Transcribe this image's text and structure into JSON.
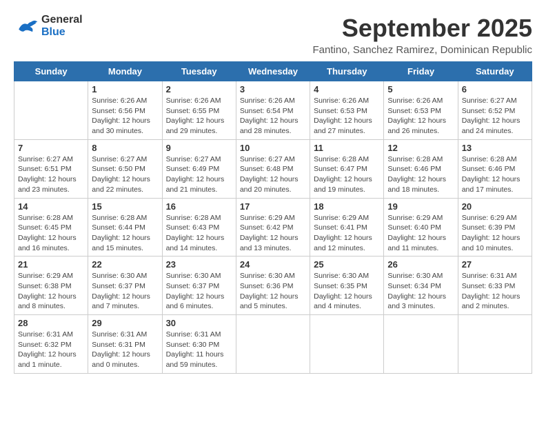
{
  "header": {
    "logo_general": "General",
    "logo_blue": "Blue",
    "month_title": "September 2025",
    "subtitle": "Fantino, Sanchez Ramirez, Dominican Republic"
  },
  "weekdays": [
    "Sunday",
    "Monday",
    "Tuesday",
    "Wednesday",
    "Thursday",
    "Friday",
    "Saturday"
  ],
  "weeks": [
    [
      {
        "day": "",
        "content": ""
      },
      {
        "day": "1",
        "content": "Sunrise: 6:26 AM\nSunset: 6:56 PM\nDaylight: 12 hours\nand 30 minutes."
      },
      {
        "day": "2",
        "content": "Sunrise: 6:26 AM\nSunset: 6:55 PM\nDaylight: 12 hours\nand 29 minutes."
      },
      {
        "day": "3",
        "content": "Sunrise: 6:26 AM\nSunset: 6:54 PM\nDaylight: 12 hours\nand 28 minutes."
      },
      {
        "day": "4",
        "content": "Sunrise: 6:26 AM\nSunset: 6:53 PM\nDaylight: 12 hours\nand 27 minutes."
      },
      {
        "day": "5",
        "content": "Sunrise: 6:26 AM\nSunset: 6:53 PM\nDaylight: 12 hours\nand 26 minutes."
      },
      {
        "day": "6",
        "content": "Sunrise: 6:27 AM\nSunset: 6:52 PM\nDaylight: 12 hours\nand 24 minutes."
      }
    ],
    [
      {
        "day": "7",
        "content": "Sunrise: 6:27 AM\nSunset: 6:51 PM\nDaylight: 12 hours\nand 23 minutes."
      },
      {
        "day": "8",
        "content": "Sunrise: 6:27 AM\nSunset: 6:50 PM\nDaylight: 12 hours\nand 22 minutes."
      },
      {
        "day": "9",
        "content": "Sunrise: 6:27 AM\nSunset: 6:49 PM\nDaylight: 12 hours\nand 21 minutes."
      },
      {
        "day": "10",
        "content": "Sunrise: 6:27 AM\nSunset: 6:48 PM\nDaylight: 12 hours\nand 20 minutes."
      },
      {
        "day": "11",
        "content": "Sunrise: 6:28 AM\nSunset: 6:47 PM\nDaylight: 12 hours\nand 19 minutes."
      },
      {
        "day": "12",
        "content": "Sunrise: 6:28 AM\nSunset: 6:46 PM\nDaylight: 12 hours\nand 18 minutes."
      },
      {
        "day": "13",
        "content": "Sunrise: 6:28 AM\nSunset: 6:46 PM\nDaylight: 12 hours\nand 17 minutes."
      }
    ],
    [
      {
        "day": "14",
        "content": "Sunrise: 6:28 AM\nSunset: 6:45 PM\nDaylight: 12 hours\nand 16 minutes."
      },
      {
        "day": "15",
        "content": "Sunrise: 6:28 AM\nSunset: 6:44 PM\nDaylight: 12 hours\nand 15 minutes."
      },
      {
        "day": "16",
        "content": "Sunrise: 6:28 AM\nSunset: 6:43 PM\nDaylight: 12 hours\nand 14 minutes."
      },
      {
        "day": "17",
        "content": "Sunrise: 6:29 AM\nSunset: 6:42 PM\nDaylight: 12 hours\nand 13 minutes."
      },
      {
        "day": "18",
        "content": "Sunrise: 6:29 AM\nSunset: 6:41 PM\nDaylight: 12 hours\nand 12 minutes."
      },
      {
        "day": "19",
        "content": "Sunrise: 6:29 AM\nSunset: 6:40 PM\nDaylight: 12 hours\nand 11 minutes."
      },
      {
        "day": "20",
        "content": "Sunrise: 6:29 AM\nSunset: 6:39 PM\nDaylight: 12 hours\nand 10 minutes."
      }
    ],
    [
      {
        "day": "21",
        "content": "Sunrise: 6:29 AM\nSunset: 6:38 PM\nDaylight: 12 hours\nand 8 minutes."
      },
      {
        "day": "22",
        "content": "Sunrise: 6:30 AM\nSunset: 6:37 PM\nDaylight: 12 hours\nand 7 minutes."
      },
      {
        "day": "23",
        "content": "Sunrise: 6:30 AM\nSunset: 6:37 PM\nDaylight: 12 hours\nand 6 minutes."
      },
      {
        "day": "24",
        "content": "Sunrise: 6:30 AM\nSunset: 6:36 PM\nDaylight: 12 hours\nand 5 minutes."
      },
      {
        "day": "25",
        "content": "Sunrise: 6:30 AM\nSunset: 6:35 PM\nDaylight: 12 hours\nand 4 minutes."
      },
      {
        "day": "26",
        "content": "Sunrise: 6:30 AM\nSunset: 6:34 PM\nDaylight: 12 hours\nand 3 minutes."
      },
      {
        "day": "27",
        "content": "Sunrise: 6:31 AM\nSunset: 6:33 PM\nDaylight: 12 hours\nand 2 minutes."
      }
    ],
    [
      {
        "day": "28",
        "content": "Sunrise: 6:31 AM\nSunset: 6:32 PM\nDaylight: 12 hours\nand 1 minute."
      },
      {
        "day": "29",
        "content": "Sunrise: 6:31 AM\nSunset: 6:31 PM\nDaylight: 12 hours\nand 0 minutes."
      },
      {
        "day": "30",
        "content": "Sunrise: 6:31 AM\nSunset: 6:30 PM\nDaylight: 11 hours\nand 59 minutes."
      },
      {
        "day": "",
        "content": ""
      },
      {
        "day": "",
        "content": ""
      },
      {
        "day": "",
        "content": ""
      },
      {
        "day": "",
        "content": ""
      }
    ]
  ]
}
